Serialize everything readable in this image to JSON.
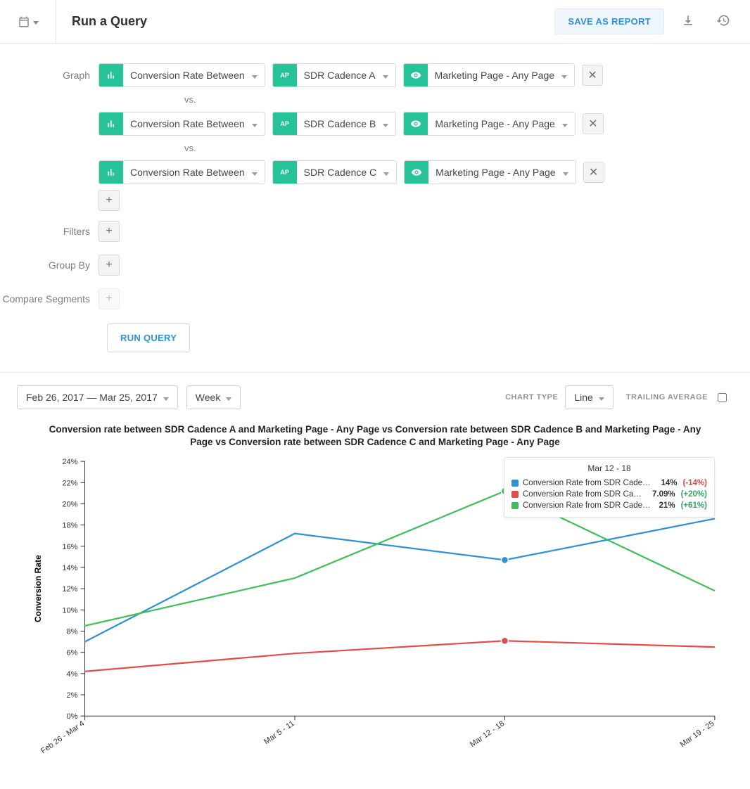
{
  "header": {
    "title": "Run a Query",
    "save_report": "SAVE AS REPORT"
  },
  "builder": {
    "labels": {
      "graph": "Graph",
      "filters": "Filters",
      "group_by": "Group By",
      "compare_segments": "Compare Segments",
      "vs": "vs."
    },
    "rows": [
      {
        "metric": "Conversion Rate Between",
        "event": "SDR Cadence A",
        "page": "Marketing Page - Any Page"
      },
      {
        "metric": "Conversion Rate Between",
        "event": "SDR Cadence B",
        "page": "Marketing Page - Any Page"
      },
      {
        "metric": "Conversion Rate Between",
        "event": "SDR Cadence C",
        "page": "Marketing Page - Any Page"
      }
    ],
    "run_query": "RUN QUERY"
  },
  "chart_controls": {
    "date_range": "Feb 26, 2017 — Mar 25, 2017",
    "granularity": "Week",
    "chart_type_label": "CHART TYPE",
    "chart_type_value": "Line",
    "trailing_average_label": "TRAILING AVERAGE",
    "trailing_average_checked": false
  },
  "chart_data": {
    "type": "line",
    "title": "Conversion rate between SDR Cadence A and Marketing Page - Any Page vs Conversion rate between SDR Cadence B and Marketing Page - Any Page vs Conversion rate between SDR Cadence C and Marketing Page - Any Page",
    "ylabel": "Conversion Rate",
    "xlabel": "",
    "categories": [
      "Feb 26 - Mar 4",
      "Mar 5 - 11",
      "Mar 12 - 18",
      "Mar 19 - 25"
    ],
    "ylim": [
      0,
      24
    ],
    "ytick_step": 2,
    "y_format": "percent",
    "colors": {
      "A": "#2e91d4",
      "B": "#e44b4b",
      "C": "#3fbf5a"
    },
    "series": [
      {
        "id": "A",
        "name": "Conversion Rate from SDR Cadence A ...",
        "values": [
          7.0,
          17.2,
          14.7,
          18.6
        ]
      },
      {
        "id": "B",
        "name": "Conversion Rate from SDR Cadence B ...",
        "values": [
          4.2,
          5.9,
          7.09,
          6.5
        ]
      },
      {
        "id": "C",
        "name": "Conversion Rate from SDR Cadence C ...",
        "values": [
          8.5,
          13.0,
          21.2,
          11.8
        ]
      }
    ],
    "highlight_index": 2,
    "tooltip": {
      "title": "Mar 12 - 18",
      "rows": [
        {
          "series": "A",
          "value": "14%",
          "delta": "(-14%)",
          "delta_sign": "neg"
        },
        {
          "series": "B",
          "value": "7.09%",
          "delta": "(+20%)",
          "delta_sign": "pos"
        },
        {
          "series": "C",
          "value": "21%",
          "delta": "(+61%)",
          "delta_sign": "pos"
        }
      ]
    }
  }
}
